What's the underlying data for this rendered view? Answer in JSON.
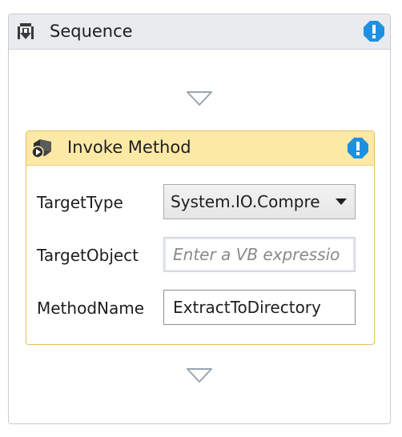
{
  "sequence": {
    "title": "Sequence",
    "icon": "sequence-icon"
  },
  "invoke_method": {
    "title": "Invoke Method",
    "icon": "invoke-method-icon",
    "fields": {
      "target_type": {
        "label": "TargetType",
        "value": "System.IO.Compre"
      },
      "target_object": {
        "label": "TargetObject",
        "placeholder": "Enter a VB expressio",
        "value": ""
      },
      "method_name": {
        "label": "MethodName",
        "value": "ExtractToDirectory"
      }
    }
  },
  "colors": {
    "sequence_header": "#e9ebef",
    "activity_header": "#fde9a6",
    "activity_border": "#e3c25e",
    "warning_blue": "#1e90e0"
  }
}
